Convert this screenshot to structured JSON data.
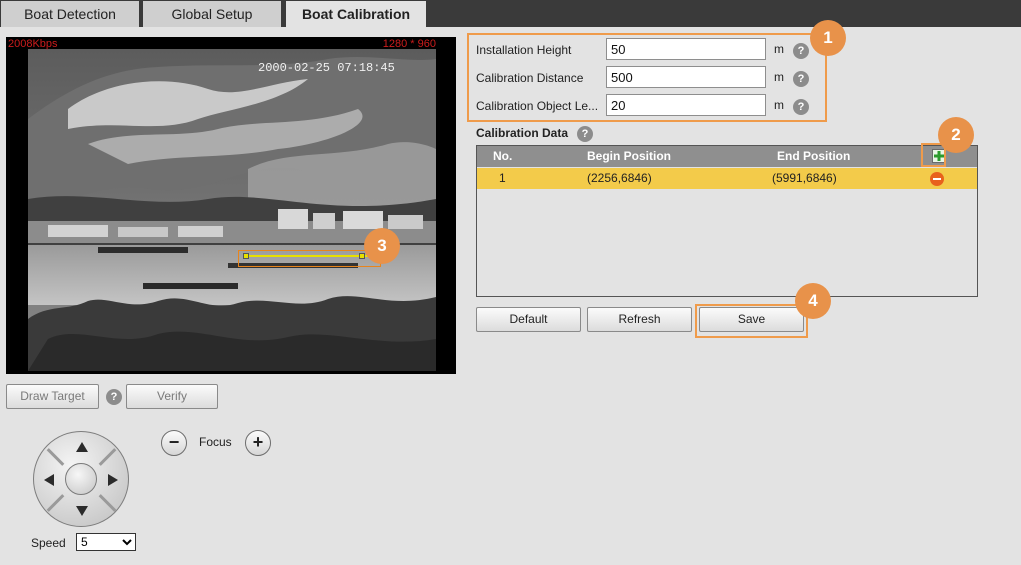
{
  "tabs": [
    {
      "label": "Boat Detection",
      "active": false
    },
    {
      "label": "Global Setup",
      "active": false
    },
    {
      "label": "Boat Calibration",
      "active": true
    }
  ],
  "video": {
    "bitrate": "2008Kbps",
    "resolution": "1280 * 960",
    "timestamp": "2000-02-25 07:18:45"
  },
  "left_controls": {
    "draw_target": "Draw Target",
    "help": "?",
    "verify": "Verify",
    "focus_label": "Focus",
    "focus_minus": "−",
    "focus_plus": "+",
    "speed_label": "Speed",
    "speed_value": "5"
  },
  "form": {
    "fields": [
      {
        "label": "Installation Height",
        "value": "50",
        "unit": "m"
      },
      {
        "label": "Calibration Distance",
        "value": "500",
        "unit": "m"
      },
      {
        "label": "Calibration Object Le...",
        "value": "20",
        "unit": "m"
      }
    ],
    "help": "?"
  },
  "calibration": {
    "title": "Calibration Data",
    "columns": [
      "No.",
      "Begin Position",
      "End Position"
    ],
    "rows": [
      {
        "no": "1",
        "begin": "(2256,6846)",
        "end": "(5991,6846)"
      }
    ]
  },
  "actions": {
    "default": "Default",
    "refresh": "Refresh",
    "save": "Save"
  },
  "callouts": [
    "1",
    "2",
    "3",
    "4"
  ],
  "colors": {
    "accent_orange": "#e8924a",
    "row_highlight": "#f3cb4a",
    "header_gray": "#8f8f8f",
    "tab_bar": "#3a3a3a"
  },
  "icons": {
    "add": "add-row-icon",
    "delete": "delete-row-icon",
    "help": "help-icon"
  }
}
